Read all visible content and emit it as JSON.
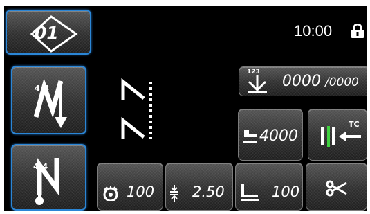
{
  "header": {
    "program_number": "01",
    "clock": "10:00",
    "lock_icon": "lock-icon"
  },
  "left_panel": {
    "start_bartack_label": "4 4",
    "end_bartack_label": "4 4"
  },
  "counter": {
    "value": "0000",
    "total": "/0000",
    "badge": "123"
  },
  "presser_pressure": {
    "value": "4000"
  },
  "thread_trimmer": {
    "label": "TC"
  },
  "bottom": {
    "speed_value": "100",
    "stitch_pitch_value": "2.50",
    "foot_value": "100"
  },
  "colors": {
    "accent_blue": "#2b86d6",
    "green_indicator": "#3fd13f",
    "background": "#000000"
  }
}
